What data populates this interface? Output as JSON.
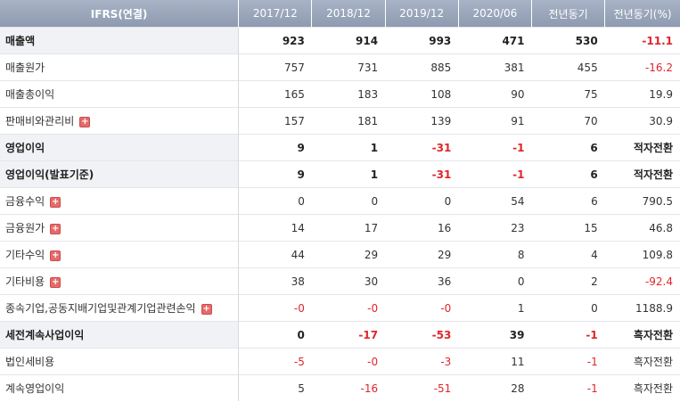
{
  "colors": {
    "negative": "#e0262b",
    "header_bg": "#97a3b8",
    "bold_row_label_bg": "#f1f2f5"
  },
  "header": [
    "IFRS(연결)",
    "2017/12",
    "2018/12",
    "2019/12",
    "2020/06",
    "전년동기",
    "전년동기(%)"
  ],
  "rows": [
    {
      "label": "매출액",
      "bold": true,
      "expand": false,
      "values": [
        "923",
        "914",
        "993",
        "471",
        "530",
        "-11.1"
      ]
    },
    {
      "label": "매출원가",
      "bold": false,
      "expand": false,
      "values": [
        "757",
        "731",
        "885",
        "381",
        "455",
        "-16.2"
      ]
    },
    {
      "label": "매출총이익",
      "bold": false,
      "expand": false,
      "values": [
        "165",
        "183",
        "108",
        "90",
        "75",
        "19.9"
      ]
    },
    {
      "label": "판매비와관리비",
      "bold": false,
      "expand": true,
      "values": [
        "157",
        "181",
        "139",
        "91",
        "70",
        "30.9"
      ]
    },
    {
      "label": "영업이익",
      "bold": true,
      "expand": false,
      "values": [
        "9",
        "1",
        "-31",
        "-1",
        "6",
        "적자전환"
      ]
    },
    {
      "label": "영업이익(발표기준)",
      "bold": true,
      "expand": false,
      "values": [
        "9",
        "1",
        "-31",
        "-1",
        "6",
        "적자전환"
      ]
    },
    {
      "label": "금융수익",
      "bold": false,
      "expand": true,
      "values": [
        "0",
        "0",
        "0",
        "54",
        "6",
        "790.5"
      ]
    },
    {
      "label": "금융원가",
      "bold": false,
      "expand": true,
      "values": [
        "14",
        "17",
        "16",
        "23",
        "15",
        "46.8"
      ]
    },
    {
      "label": "기타수익",
      "bold": false,
      "expand": true,
      "values": [
        "44",
        "29",
        "29",
        "8",
        "4",
        "109.8"
      ]
    },
    {
      "label": "기타비용",
      "bold": false,
      "expand": true,
      "values": [
        "38",
        "30",
        "36",
        "0",
        "2",
        "-92.4"
      ]
    },
    {
      "label": "종속기업,공동지배기업및관계기업관련손익",
      "bold": false,
      "expand": true,
      "values": [
        "-0",
        "-0",
        "-0",
        "1",
        "0",
        "1188.9"
      ]
    },
    {
      "label": "세전계속사업이익",
      "bold": true,
      "expand": false,
      "values": [
        "0",
        "-17",
        "-53",
        "39",
        "-1",
        "흑자전환"
      ]
    },
    {
      "label": "법인세비용",
      "bold": false,
      "expand": false,
      "values": [
        "-5",
        "-0",
        "-3",
        "11",
        "-1",
        "흑자전환"
      ]
    },
    {
      "label": "계속영업이익",
      "bold": false,
      "expand": false,
      "values": [
        "5",
        "-16",
        "-51",
        "28",
        "-1",
        "흑자전환"
      ]
    }
  ]
}
